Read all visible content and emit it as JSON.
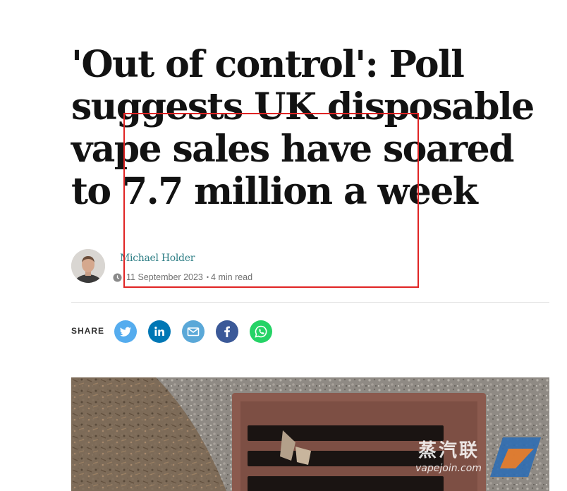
{
  "article": {
    "headline": "'Out of control': Poll suggests UK disposable vape sales have soared to 7.7 million a week",
    "author": "Michael Holder",
    "date": "11 September 2023",
    "read_time": "4 min read"
  },
  "share": {
    "label": "SHARE",
    "buttons": [
      {
        "name": "twitter",
        "icon": "twitter-icon",
        "color": "#55acee"
      },
      {
        "name": "linkedin",
        "icon": "linkedin-icon",
        "color": "#0077b5"
      },
      {
        "name": "email",
        "icon": "email-icon",
        "color": "#5aa8d8"
      },
      {
        "name": "facebook",
        "icon": "facebook-icon",
        "color": "#3b5998"
      },
      {
        "name": "whatsapp",
        "icon": "whatsapp-icon",
        "color": "#25d366"
      }
    ]
  },
  "watermark": {
    "title": "蒸汽联",
    "subtitle": "vapejoin.com"
  },
  "colors": {
    "annotation": "#e02424",
    "author_link": "#2f7f86"
  }
}
